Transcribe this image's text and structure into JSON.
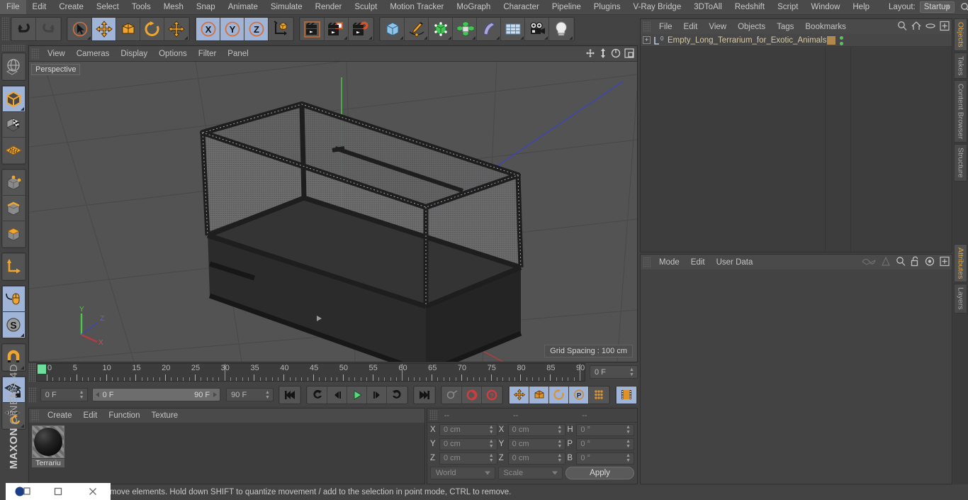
{
  "menubar": {
    "items": [
      "File",
      "Edit",
      "Create",
      "Select",
      "Tools",
      "Mesh",
      "Snap",
      "Animate",
      "Simulate",
      "Render",
      "Sculpt",
      "Motion Tracker",
      "MoGraph",
      "Character",
      "Pipeline",
      "Plugins",
      "V-Ray Bridge",
      "3DToAll",
      "Redshift",
      "Script",
      "Window",
      "Help"
    ],
    "layout_label": "Layout:",
    "layout_value": "Startup",
    "search_icon": "search-icon"
  },
  "toolbar": {
    "groups": [
      {
        "name": "undo-redo",
        "buttons": [
          {
            "name": "undo-button",
            "icon": "undo-arrow-icon",
            "selected": false
          },
          {
            "name": "redo-button",
            "icon": "redo-arrow-icon",
            "selected": false
          }
        ]
      },
      {
        "name": "transform-tools",
        "buttons": [
          {
            "name": "live-selection-tool",
            "icon": "cursor-circle-icon",
            "selected": false
          },
          {
            "name": "move-tool",
            "icon": "move-cross-icon",
            "selected": true
          },
          {
            "name": "scale-tool",
            "icon": "scale-box-icon",
            "selected": false
          },
          {
            "name": "rotate-tool",
            "icon": "rotate-arc-icon",
            "selected": false
          },
          {
            "name": "generic-move-tool",
            "icon": "move-cross-icon",
            "selected": false
          }
        ]
      },
      {
        "name": "axis-locks",
        "buttons": [
          {
            "name": "lock-x-axis",
            "icon": "x-axis-icon",
            "label": "X",
            "selected": true
          },
          {
            "name": "lock-y-axis",
            "icon": "y-axis-icon",
            "label": "Y",
            "selected": true
          },
          {
            "name": "lock-z-axis",
            "icon": "z-axis-icon",
            "label": "Z",
            "selected": true
          },
          {
            "name": "world-object-coord-toggle",
            "icon": "world-coord-cube-icon",
            "selected": false
          }
        ]
      },
      {
        "name": "render-tools",
        "buttons": [
          {
            "name": "render-view-button",
            "icon": "render-clapper-icon",
            "selected": false
          },
          {
            "name": "render-region-button",
            "icon": "render-region-clapper-icon",
            "selected": false
          },
          {
            "name": "render-settings-button",
            "icon": "render-settings-gear-icon",
            "selected": false
          }
        ]
      },
      {
        "name": "create-objects",
        "buttons": [
          {
            "name": "add-cube-primitive",
            "icon": "cube-icon",
            "selected": false
          },
          {
            "name": "add-spline",
            "icon": "pen-spline-icon",
            "selected": false
          },
          {
            "name": "add-generator",
            "icon": "green-cube-generator-icon",
            "selected": false
          },
          {
            "name": "add-array",
            "icon": "array-cluster-icon",
            "selected": false
          },
          {
            "name": "add-deformer",
            "icon": "bend-deformer-icon",
            "selected": false
          },
          {
            "name": "add-environment",
            "icon": "floor-grid-icon",
            "selected": false
          },
          {
            "name": "add-camera",
            "icon": "camera-icon",
            "selected": false
          },
          {
            "name": "add-light",
            "icon": "lightbulb-icon",
            "selected": false
          }
        ]
      }
    ]
  },
  "left_toolbar": {
    "groups": [
      {
        "name": "viewport-nav",
        "buttons": [
          {
            "name": "undo-view-button",
            "icon": "globe-wire-icon",
            "selected": false
          }
        ]
      },
      {
        "name": "selection-modes",
        "buttons": [
          {
            "name": "make-editable-button",
            "icon": "orange-cube-icon",
            "selected": true
          },
          {
            "name": "enable-axis-modification",
            "icon": "checker-cube-icon",
            "selected": false
          },
          {
            "name": "enable-snapping-plane",
            "icon": "orange-grid-plane-icon",
            "selected": false
          }
        ]
      },
      {
        "name": "component-modes",
        "buttons": [
          {
            "name": "points-mode-button",
            "icon": "points-cube-icon",
            "selected": false
          },
          {
            "name": "edges-mode-button",
            "icon": "edges-cube-icon",
            "selected": false
          },
          {
            "name": "polygons-mode-button",
            "icon": "polygons-cube-icon",
            "selected": false
          }
        ]
      },
      {
        "name": "axis-mode",
        "buttons": [
          {
            "name": "object-axis-button",
            "icon": "axis-corner-icon",
            "selected": false
          }
        ]
      },
      {
        "name": "interaction-modes",
        "buttons": [
          {
            "name": "viewport-solo-button",
            "icon": "mouse-curve-icon",
            "selected": true
          },
          {
            "name": "soft-selection-button",
            "icon": "s-circle-icon",
            "selected": true
          }
        ]
      },
      {
        "name": "snap-group",
        "buttons": [
          {
            "name": "enable-snap-button",
            "icon": "magnet-icon",
            "selected": false
          }
        ]
      },
      {
        "name": "workplane-group",
        "buttons": [
          {
            "name": "lock-workplane-button",
            "icon": "grid-lock-icon",
            "selected": true
          },
          {
            "name": "workplane-mode-button",
            "icon": "grid-rotate-icon",
            "selected": false
          }
        ]
      }
    ],
    "brand_bold": "MAXON",
    "brand_light": "CINEMA 4D"
  },
  "viewport": {
    "menu_items": [
      "View",
      "Cameras",
      "Display",
      "Options",
      "Filter",
      "Panel"
    ],
    "corner_icons": [
      "pan-view-icon",
      "zoom-view-icon",
      "rotate-view-icon",
      "maximize-view-icon"
    ],
    "label": "Perspective",
    "grid_spacing": "Grid Spacing : 100 cm",
    "axis_gizmo": {
      "y": "Y",
      "z": "Z",
      "x": "X"
    }
  },
  "timeline": {
    "tick_labels": [
      "0",
      "5",
      "10",
      "15",
      "20",
      "25",
      "30",
      "35",
      "40",
      "45",
      "50",
      "55",
      "60",
      "65",
      "70",
      "75",
      "80",
      "85",
      "90"
    ],
    "current_frame_field": "0 F",
    "start_frame_field": "0 F",
    "range_start": "0 F",
    "range_end": "90 F",
    "end_frame_field": "90 F",
    "controls": [
      {
        "name": "go-to-start-button",
        "icon": "skip-start-icon",
        "selected": false
      },
      {
        "name": "go-to-previous-key-button",
        "icon": "prev-key-icon",
        "selected": false
      },
      {
        "name": "step-back-button",
        "icon": "step-back-icon",
        "selected": false
      },
      {
        "name": "play-button",
        "icon": "play-icon",
        "selected": false
      },
      {
        "name": "step-forward-button",
        "icon": "step-forward-icon",
        "selected": false
      },
      {
        "name": "go-to-next-key-button",
        "icon": "next-key-icon",
        "selected": false
      },
      {
        "name": "go-to-end-button",
        "icon": "skip-end-icon",
        "selected": false
      }
    ],
    "record_controls": [
      {
        "name": "autokeying-button",
        "icon": "key-icon",
        "selected": false
      },
      {
        "name": "record-active-objects-button",
        "icon": "record-circle-icon",
        "selected": false
      },
      {
        "name": "record-question-button",
        "icon": "question-circle-icon",
        "selected": false
      }
    ],
    "key_filters": [
      {
        "name": "position-key-button",
        "icon": "move-cross-icon",
        "selected": true
      },
      {
        "name": "scale-key-button",
        "icon": "scale-box-icon",
        "selected": true
      },
      {
        "name": "rotation-key-button",
        "icon": "rotate-arc-icon",
        "selected": true
      },
      {
        "name": "parameter-key-button",
        "icon": "p-circle-icon",
        "selected": true
      },
      {
        "name": "point-level-animation-button",
        "icon": "dots-grid-icon",
        "selected": false
      },
      {
        "name": "timeline-toggle-button",
        "icon": "film-strip-icon",
        "selected": true
      }
    ]
  },
  "material_manager": {
    "menu_items": [
      "Create",
      "Edit",
      "Function",
      "Texture"
    ],
    "materials": [
      {
        "name": "Terrariu"
      }
    ]
  },
  "coordinates": {
    "headers": [
      "--",
      "--",
      "--"
    ],
    "rows": [
      {
        "label1": "X",
        "value1": "0 cm",
        "label2": "X",
        "value2": "0 cm",
        "label3": "H",
        "value3": "0 °"
      },
      {
        "label1": "Y",
        "value1": "0 cm",
        "label2": "Y",
        "value2": "0 cm",
        "label3": "P",
        "value3": "0 °"
      },
      {
        "label1": "Z",
        "value1": "0 cm",
        "label2": "Z",
        "value2": "0 cm",
        "label3": "B",
        "value3": "0 °"
      }
    ],
    "system_dropdown": "World",
    "mode_dropdown": "Scale",
    "apply_button": "Apply"
  },
  "object_manager": {
    "menu_items": [
      "File",
      "Edit",
      "View",
      "Objects",
      "Tags",
      "Bookmarks"
    ],
    "right_icons": [
      "search-icon",
      "home-icon",
      "eye-icon",
      "plus-box-icon"
    ],
    "object_name": "Empty_Long_Terrarium_for_Exotic_Animals",
    "object_layer_badge": "0"
  },
  "attributes": {
    "menu_items": [
      "Mode",
      "Edit",
      "User Data"
    ],
    "right_icons": [
      "wave-icon",
      "cone-icon",
      "search-icon",
      "unlock-icon",
      "target-icon",
      "plus-box-icon"
    ]
  },
  "vertical_tabs": [
    {
      "label": "Objects",
      "active": true
    },
    {
      "label": "Takes",
      "active": false
    },
    {
      "label": "Content Browser",
      "active": false
    },
    {
      "label": "Structure",
      "active": false
    },
    {
      "label": "Attributes",
      "active": true
    },
    {
      "label": "Layers",
      "active": false
    }
  ],
  "statusbar": {
    "message": "move elements. Hold down SHIFT to quantize movement / add to the selection in point mode, CTRL to remove.",
    "window_buttons": [
      "app-icon",
      "restore-button",
      "minimize-button",
      "close-button"
    ]
  },
  "colors": {
    "accent_orange": "#e0a846",
    "selected_blue": "#9fb4d6",
    "panel_bg": "#434343",
    "viewport_bg": "#535353",
    "object_name_color": "#d4c9a8",
    "axis_x": "#c84b4b",
    "axis_y": "#4bc84b",
    "axis_z": "#4b4bc8"
  }
}
